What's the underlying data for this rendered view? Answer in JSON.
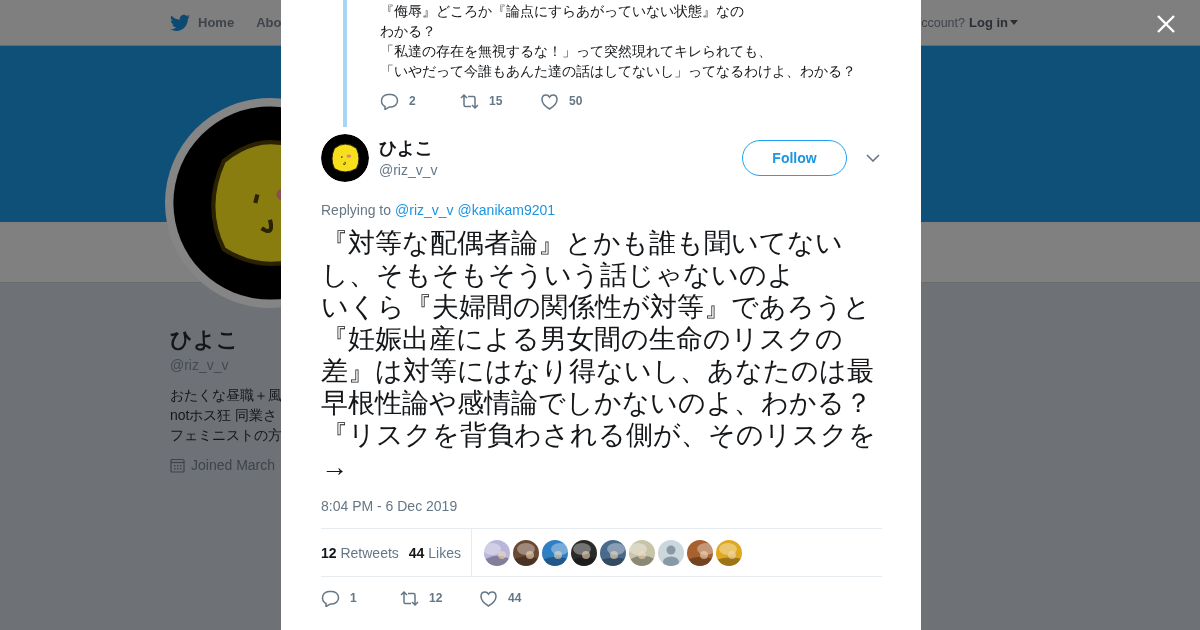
{
  "top_nav": {
    "links": [
      {
        "label": "Home",
        "kind": "home"
      },
      {
        "label": "Abo",
        "kind": "plain"
      }
    ],
    "account_prompt": "ccount?",
    "login": "Log in"
  },
  "profile": {
    "name": "ひよこ",
    "handle": "@riz_v_v",
    "bio": [
      "おたくな昼職＋風",
      "notホス狂 同業さ",
      "フェミニストの方"
    ],
    "joined": "Joined March"
  },
  "modal": {
    "previous_tweet": {
      "lines": [
        "『侮辱』どころか『論点にすらあがっていない状態』なの",
        "わかる？",
        "「私達の存在を無視するな！」って突然現れてキレられても、",
        "「いやだって今誰もあんた達の話はしてないし」ってなるわけよ、わかる？"
      ],
      "actions": [
        {
          "kind": "reply",
          "count": "2"
        },
        {
          "kind": "retweet",
          "count": "15"
        },
        {
          "kind": "like",
          "count": "50"
        }
      ]
    },
    "tweet": {
      "name": "ひよこ",
      "handle": "@riz_v_v",
      "follow": "Follow",
      "replying_label": "Replying to",
      "replying_to": [
        "@riz_v_v",
        "@kanikam9201"
      ],
      "text": [
        "『対等な配偶者論』とかも誰も聞いてないし、そもそもそういう話じゃないのよ",
        "いくら『夫婦間の関係性が対等』であろうと",
        "『妊娠出産による男女間の生命のリスクの差』は対等にはなり得ないし、あなたのは最早根性論や感情論でしかないのよ、わかる？",
        "『リスクを背負わされる側が、そのリスクを→"
      ],
      "timestamp": "8:04 PM - 6 Dec 2019",
      "retweets": {
        "count": "12",
        "label": "Retweets"
      },
      "likes": {
        "count": "44",
        "label": "Likes"
      },
      "likers": [
        {
          "kind": "picture",
          "color": "#b9b6dc"
        },
        {
          "kind": "picture",
          "color": "#6b4a35"
        },
        {
          "kind": "picture",
          "color": "#2f7fc4"
        },
        {
          "kind": "picture",
          "color": "#2a2a2a"
        },
        {
          "kind": "picture",
          "color": "#4a6a8c"
        },
        {
          "kind": "picture",
          "color": "#c8c4a8"
        },
        {
          "kind": "default",
          "color": "#ccd6dd"
        },
        {
          "kind": "picture",
          "color": "#a8602e"
        },
        {
          "kind": "picture",
          "color": "#e0a820"
        }
      ],
      "actions": [
        {
          "kind": "reply",
          "count": "1"
        },
        {
          "kind": "retweet",
          "count": "12"
        },
        {
          "kind": "like",
          "count": "44"
        }
      ]
    }
  }
}
